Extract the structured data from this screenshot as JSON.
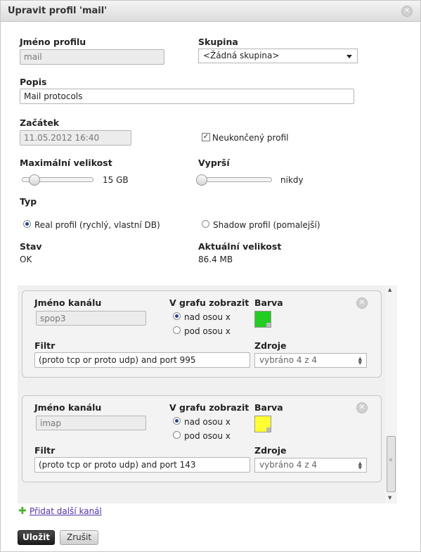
{
  "dialog": {
    "title": "Upravit profil 'mail'"
  },
  "form": {
    "profile_name_label": "Jméno profilu",
    "profile_name_value": "mail",
    "group_label": "Skupina",
    "group_value": "<Žádná skupina>",
    "description_label": "Popis",
    "description_value": "Mail protocols",
    "start_label": "Začátek",
    "start_value": "11.05.2012 16:40",
    "unfinished_label": "Neukončený profil",
    "unfinished_checked": true,
    "max_size_label": "Maximální velikost",
    "max_size_value": "15 GB",
    "max_size_level": 0.12,
    "expires_label": "Vyprší",
    "expires_value": "nikdy",
    "expires_level": 0.0,
    "type_label": "Typ",
    "type_real": "Real profil (rychlý, vlastní DB)",
    "type_shadow": "Shadow profil (pomalejší)",
    "type_selected": "real",
    "state_label": "Stav",
    "state_value": "OK",
    "current_size_label": "Aktuální velikost",
    "current_size_value": "86.4 MB"
  },
  "channels": [
    {
      "name_label": "Jméno kanálu",
      "name_value": "spop3",
      "graph_label": "V grafu zobrazit",
      "above": "nad osou x",
      "below": "pod osou x",
      "graph_selected": "above",
      "color_label": "Barva",
      "color": "#22cc22",
      "filter_label": "Filtr",
      "filter_value": "(proto tcp or proto udp) and port 995",
      "source_label": "Zdroje",
      "source_value": "vybráno 4 z 4"
    },
    {
      "name_label": "Jméno kanálu",
      "name_value": "imap",
      "graph_label": "V grafu zobrazit",
      "above": "nad osou x",
      "below": "pod osou x",
      "graph_selected": "above",
      "color_label": "Barva",
      "color": "#ffff33",
      "filter_label": "Filtr",
      "filter_value": "(proto tcp or proto udp) and port 143",
      "source_label": "Zdroje",
      "source_value": "vybráno 4 z 4"
    }
  ],
  "actions": {
    "add_channel": "Přidat další kanál",
    "save": "Uložit",
    "cancel": "Zrušit"
  },
  "icons": {
    "close": "close-icon",
    "add": "plus-icon",
    "remove_channel": "remove-icon"
  }
}
